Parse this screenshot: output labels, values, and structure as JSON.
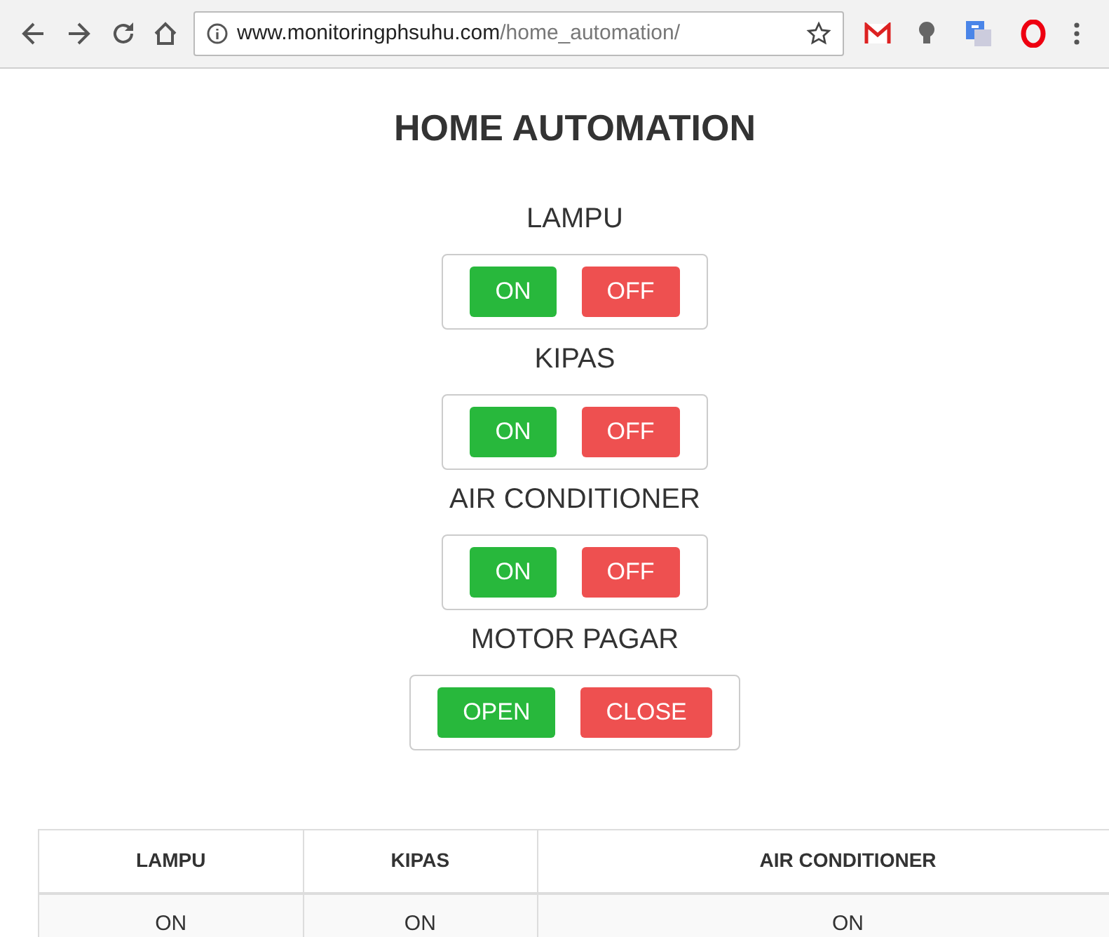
{
  "browser": {
    "url_host": "www.monitoringphsuhu.com",
    "url_path": "/home_automation/"
  },
  "title": "HOME AUTOMATION",
  "controls": [
    {
      "label": "LAMPU",
      "buttons": [
        {
          "label": "ON",
          "kind": "on"
        },
        {
          "label": "OFF",
          "kind": "off"
        }
      ]
    },
    {
      "label": "KIPAS",
      "buttons": [
        {
          "label": "ON",
          "kind": "on"
        },
        {
          "label": "OFF",
          "kind": "off"
        }
      ]
    },
    {
      "label": "AIR CONDITIONER",
      "buttons": [
        {
          "label": "ON",
          "kind": "on"
        },
        {
          "label": "OFF",
          "kind": "off"
        }
      ]
    },
    {
      "label": "MOTOR PAGAR",
      "buttons": [
        {
          "label": "OPEN",
          "kind": "on"
        },
        {
          "label": "CLOSE",
          "kind": "off"
        }
      ]
    }
  ],
  "table": {
    "columns": [
      "LAMPU",
      "KIPAS",
      "AIR CONDITIONER"
    ],
    "rows": [
      [
        "ON",
        "ON",
        "ON"
      ]
    ]
  }
}
